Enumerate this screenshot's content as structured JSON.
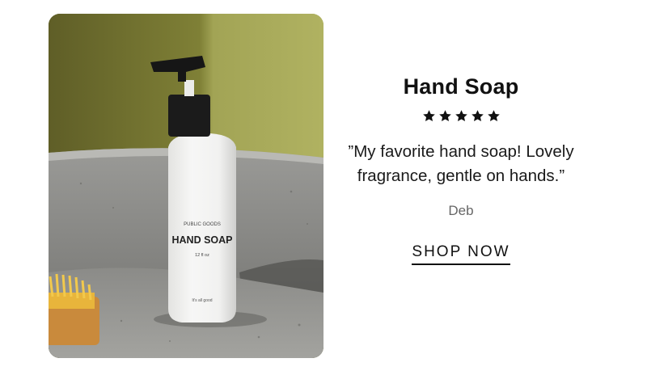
{
  "product": {
    "title": "Hand Soap",
    "rating_stars": 5,
    "bottle_brand": "PUBLIC GOODS",
    "bottle_name": "HAND SOAP",
    "bottle_size": "12 fl oz",
    "bottle_tagline": "It's all good"
  },
  "review": {
    "quote": "”My favorite hand soap! Lovely fragrance, gentle on hands.”",
    "author": "Deb"
  },
  "cta": {
    "label": "SHOP NOW"
  },
  "colors": {
    "text": "#111111",
    "author": "#666666",
    "background": "#ffffff",
    "wall": "#8f9243",
    "bottle": "#f1f1f0",
    "pump": "#1b1b1b"
  },
  "icons": {
    "star": "star-icon"
  }
}
